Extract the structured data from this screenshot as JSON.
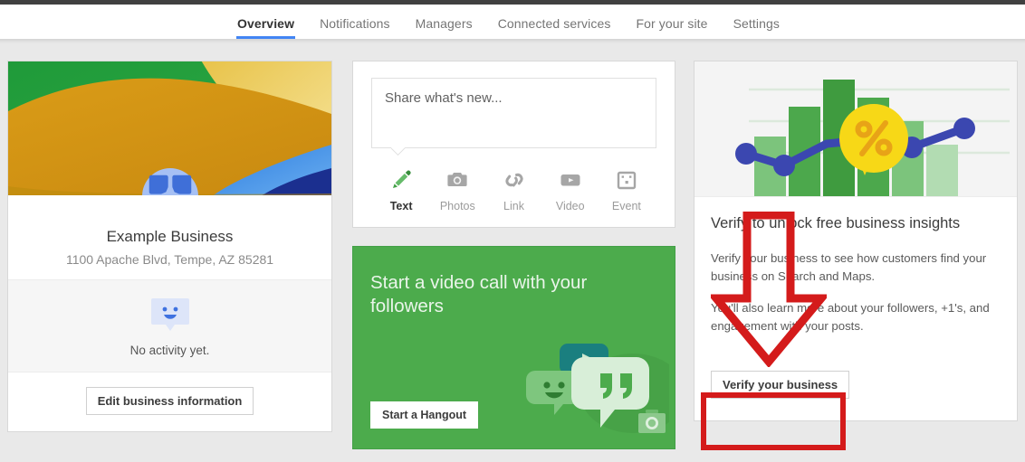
{
  "nav": {
    "tabs": [
      {
        "label": "Overview",
        "active": true
      },
      {
        "label": "Notifications",
        "active": false
      },
      {
        "label": "Managers",
        "active": false
      },
      {
        "label": "Connected services",
        "active": false
      },
      {
        "label": "For your site",
        "active": false
      },
      {
        "label": "Settings",
        "active": false
      }
    ]
  },
  "business": {
    "name": "Example Business",
    "address": "1100 Apache Blvd, Tempe, AZ 85281",
    "avatar_icon": "business-page-icon",
    "activity_icon": "smiley-speech-bubble-icon",
    "activity_text": "No activity yet.",
    "edit_button": "Edit business information"
  },
  "share": {
    "placeholder": "Share what's new...",
    "value": "",
    "items": [
      {
        "label": "Text",
        "icon": "pencil-icon",
        "active": true
      },
      {
        "label": "Photos",
        "icon": "camera-icon",
        "active": false
      },
      {
        "label": "Link",
        "icon": "link-icon",
        "active": false
      },
      {
        "label": "Video",
        "icon": "video-icon",
        "active": false
      },
      {
        "label": "Event",
        "icon": "calendar-icon",
        "active": false
      }
    ]
  },
  "hangout": {
    "title": "Start a video call with your followers",
    "button": "Start a Hangout",
    "art_icon": "hangouts-illustration"
  },
  "verify": {
    "hero_icon": "business-insights-chart",
    "title": "Verify to unlock free business insights",
    "paragraph1": "Verify your business to see how customers find your business on Search and Maps.",
    "paragraph2": "You'll also learn more about your followers, +1's, and engagement with your posts.",
    "button": "Verify your business"
  },
  "annotations": {
    "arrow": "red-down-arrow",
    "highlight_rect": "red-highlight-rectangle",
    "color": "#d41b1b"
  },
  "colors": {
    "accent_blue": "#4285f4",
    "hangout_green": "#4cab4c",
    "page_bg": "#e9e9e9",
    "annotation_red": "#d41b1b"
  }
}
